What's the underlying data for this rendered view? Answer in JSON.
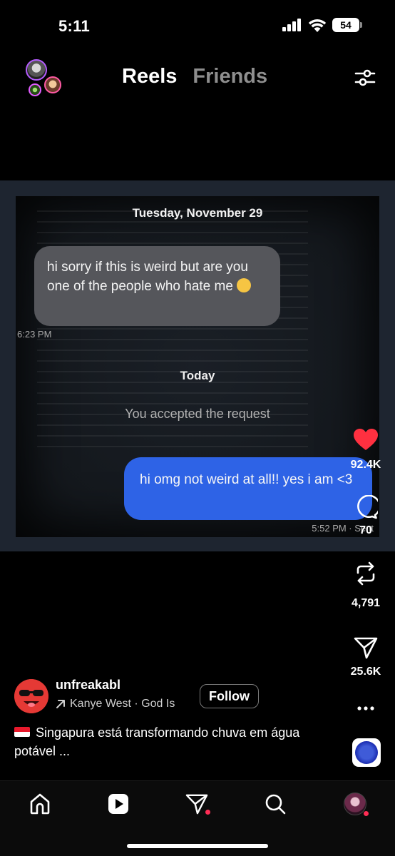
{
  "status_bar": {
    "time": "5:11",
    "battery": "54"
  },
  "header": {
    "tabs": [
      "Reels",
      "Friends"
    ],
    "active_tab": "Reels"
  },
  "media": {
    "date_header": "Tuesday, November 29",
    "incoming_message": "hi sorry if this is weird but are you one of the people who hate me",
    "incoming_time": "6:23 PM",
    "today_label": "Today",
    "system_message": "You accepted the request",
    "outgoing_message": "hi omg not weird at all!! yes i am <3",
    "outgoing_time": "5:52 PM · Sent"
  },
  "actions": {
    "likes": "92.4K",
    "comments": "70",
    "reposts": "4,791",
    "shares": "25.6K"
  },
  "creator": {
    "username": "unfreakabl",
    "audio": "Kanye West · God Is",
    "follow_label": "Follow",
    "caption": "Singapura está transformando chuva em água potável ..."
  },
  "bottom_nav": [
    "home-icon",
    "reels-icon",
    "send-icon",
    "search-icon",
    "profile-avatar"
  ],
  "colors": {
    "like": "#ff3040",
    "notification_dot": "#ff2d55",
    "outgoing_bubble": "#2e63e6"
  }
}
